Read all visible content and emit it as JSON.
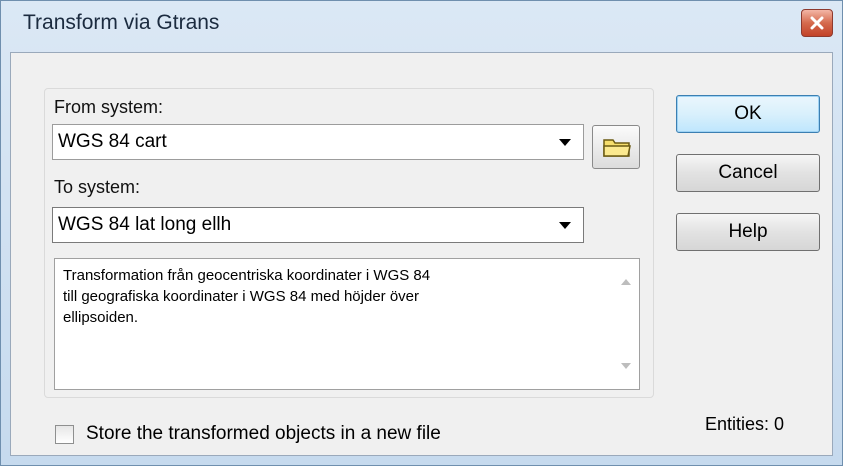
{
  "window": {
    "title": "Transform via Gtrans"
  },
  "from": {
    "label": "From system:",
    "value": "WGS 84 cart"
  },
  "to": {
    "label": "To system:",
    "value": "WGS 84 lat long ellh"
  },
  "description": "Transformation från geocentriska koordinater i WGS 84\ntill geografiska koordinater i WGS 84 med höjder över\nellipsoiden.",
  "buttons": {
    "ok": "OK",
    "cancel": "Cancel",
    "help": "Help"
  },
  "store": {
    "label": "Store the transformed objects  in a new file",
    "checked": false
  },
  "entities": "Entities: 0",
  "icons": {
    "close": "close-icon",
    "folder": "folder-icon",
    "dropdown": "chevron-down-icon"
  }
}
